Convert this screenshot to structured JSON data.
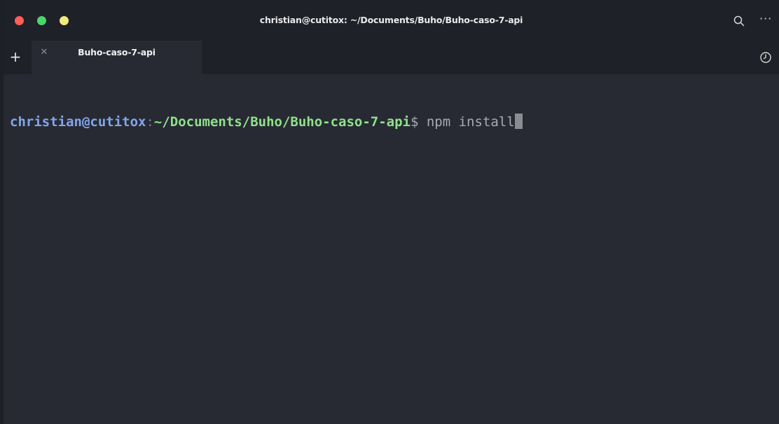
{
  "window": {
    "title": "christian@cutitox: ~/Documents/Buho/Buho-caso-7-api",
    "traffic_lights": {
      "close_color": "#ff5f57",
      "minimize_color": "#4ad66b",
      "maximize_color": "#f3ea7c"
    }
  },
  "toolbar": {
    "search_icon": "search-icon",
    "more_icon": "more-horizontal-icon",
    "more_glyph": "···"
  },
  "tabbar": {
    "new_tab_glyph": "+",
    "history_icon": "history-clock-icon",
    "tabs": [
      {
        "label": "Buho-caso-7-api",
        "close_glyph": "✕",
        "active": true
      }
    ]
  },
  "terminal": {
    "prompt_user": "christian@cutitox",
    "prompt_separator": ":",
    "prompt_path": "~/Documents/Buho/Buho-caso-7-api",
    "prompt_symbol": "$",
    "command": " npm install",
    "colors": {
      "background": "#282a33",
      "user": "#81a6ec",
      "path": "#8ee28a",
      "text": "#a7a9b3"
    }
  }
}
